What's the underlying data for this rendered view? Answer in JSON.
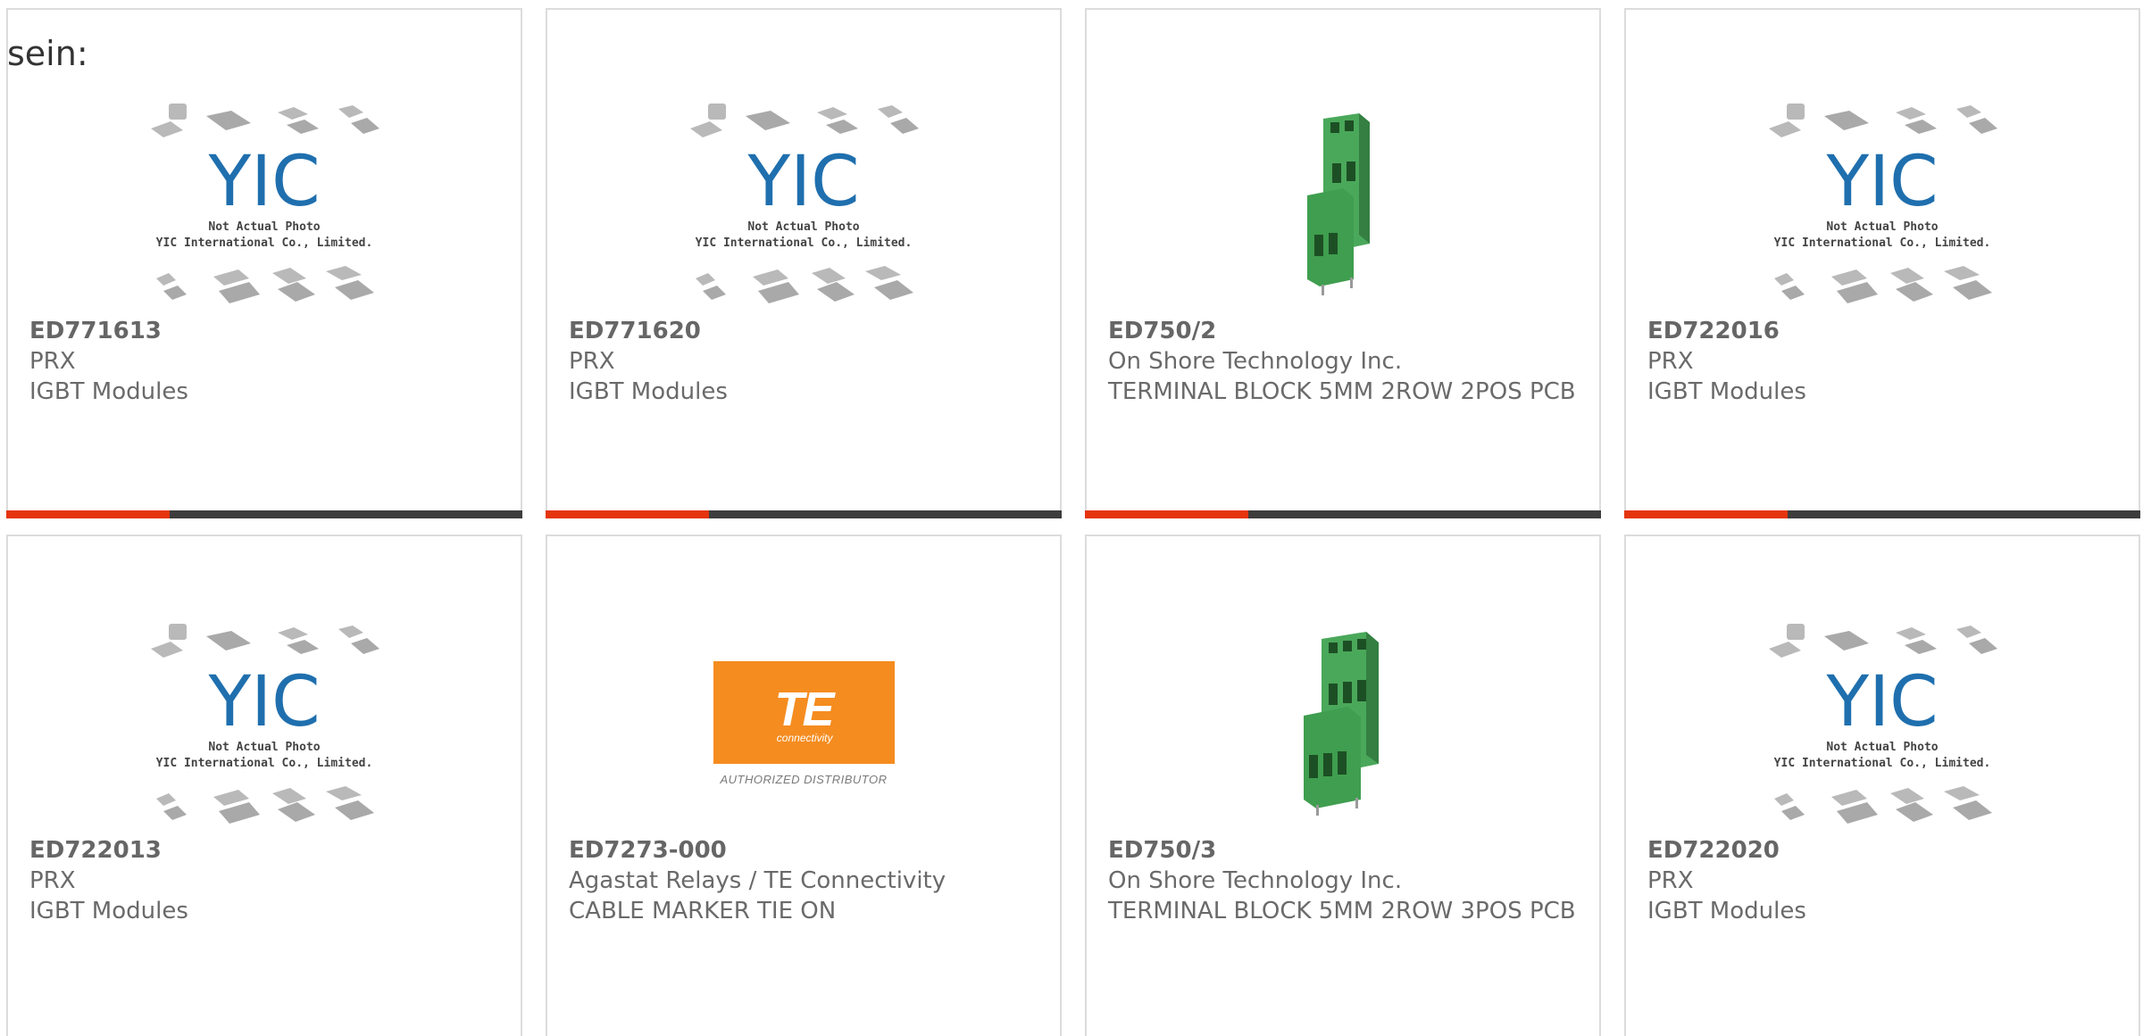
{
  "leading_text": "sein:",
  "colors": {
    "accent": "#e5350f",
    "bar": "#3d3d3d",
    "border": "#dcdcdc",
    "te_orange": "#f58c20",
    "terminal_green": "#3f9e4f"
  },
  "placeholder": {
    "line1": "Not Actual Photo",
    "line2": "YIC International Co., Limited.",
    "logo_text": "YIC"
  },
  "te": {
    "brand": "TE",
    "sub": "connectivity",
    "distributor": "AUTHORIZED DISTRIBUTOR"
  },
  "products": [
    {
      "part": "ED771613",
      "manufacturer": "PRX",
      "description": "IGBT Modules",
      "image": "yic-placeholder-icon"
    },
    {
      "part": "ED771620",
      "manufacturer": "PRX",
      "description": "IGBT Modules",
      "image": "yic-placeholder-icon"
    },
    {
      "part": "ED750/2",
      "manufacturer": "On Shore Technology Inc.",
      "description": "TERMINAL BLOCK 5MM 2ROW 2POS PCB",
      "image": "terminal-block-2pos-icon"
    },
    {
      "part": "ED722016",
      "manufacturer": "PRX",
      "description": "IGBT Modules",
      "image": "yic-placeholder-icon"
    },
    {
      "part": "ED722013",
      "manufacturer": "PRX",
      "description": "IGBT Modules",
      "image": "yic-placeholder-icon"
    },
    {
      "part": "ED7273-000",
      "manufacturer": "Agastat Relays / TE Connectivity",
      "description": "CABLE MARKER TIE ON",
      "image": "te-connectivity-logo"
    },
    {
      "part": "ED750/3",
      "manufacturer": "On Shore Technology Inc.",
      "description": "TERMINAL BLOCK 5MM 2ROW 3POS PCB",
      "image": "terminal-block-3pos-icon"
    },
    {
      "part": "ED722020",
      "manufacturer": "PRX",
      "description": "IGBT Modules",
      "image": "yic-placeholder-icon"
    }
  ]
}
